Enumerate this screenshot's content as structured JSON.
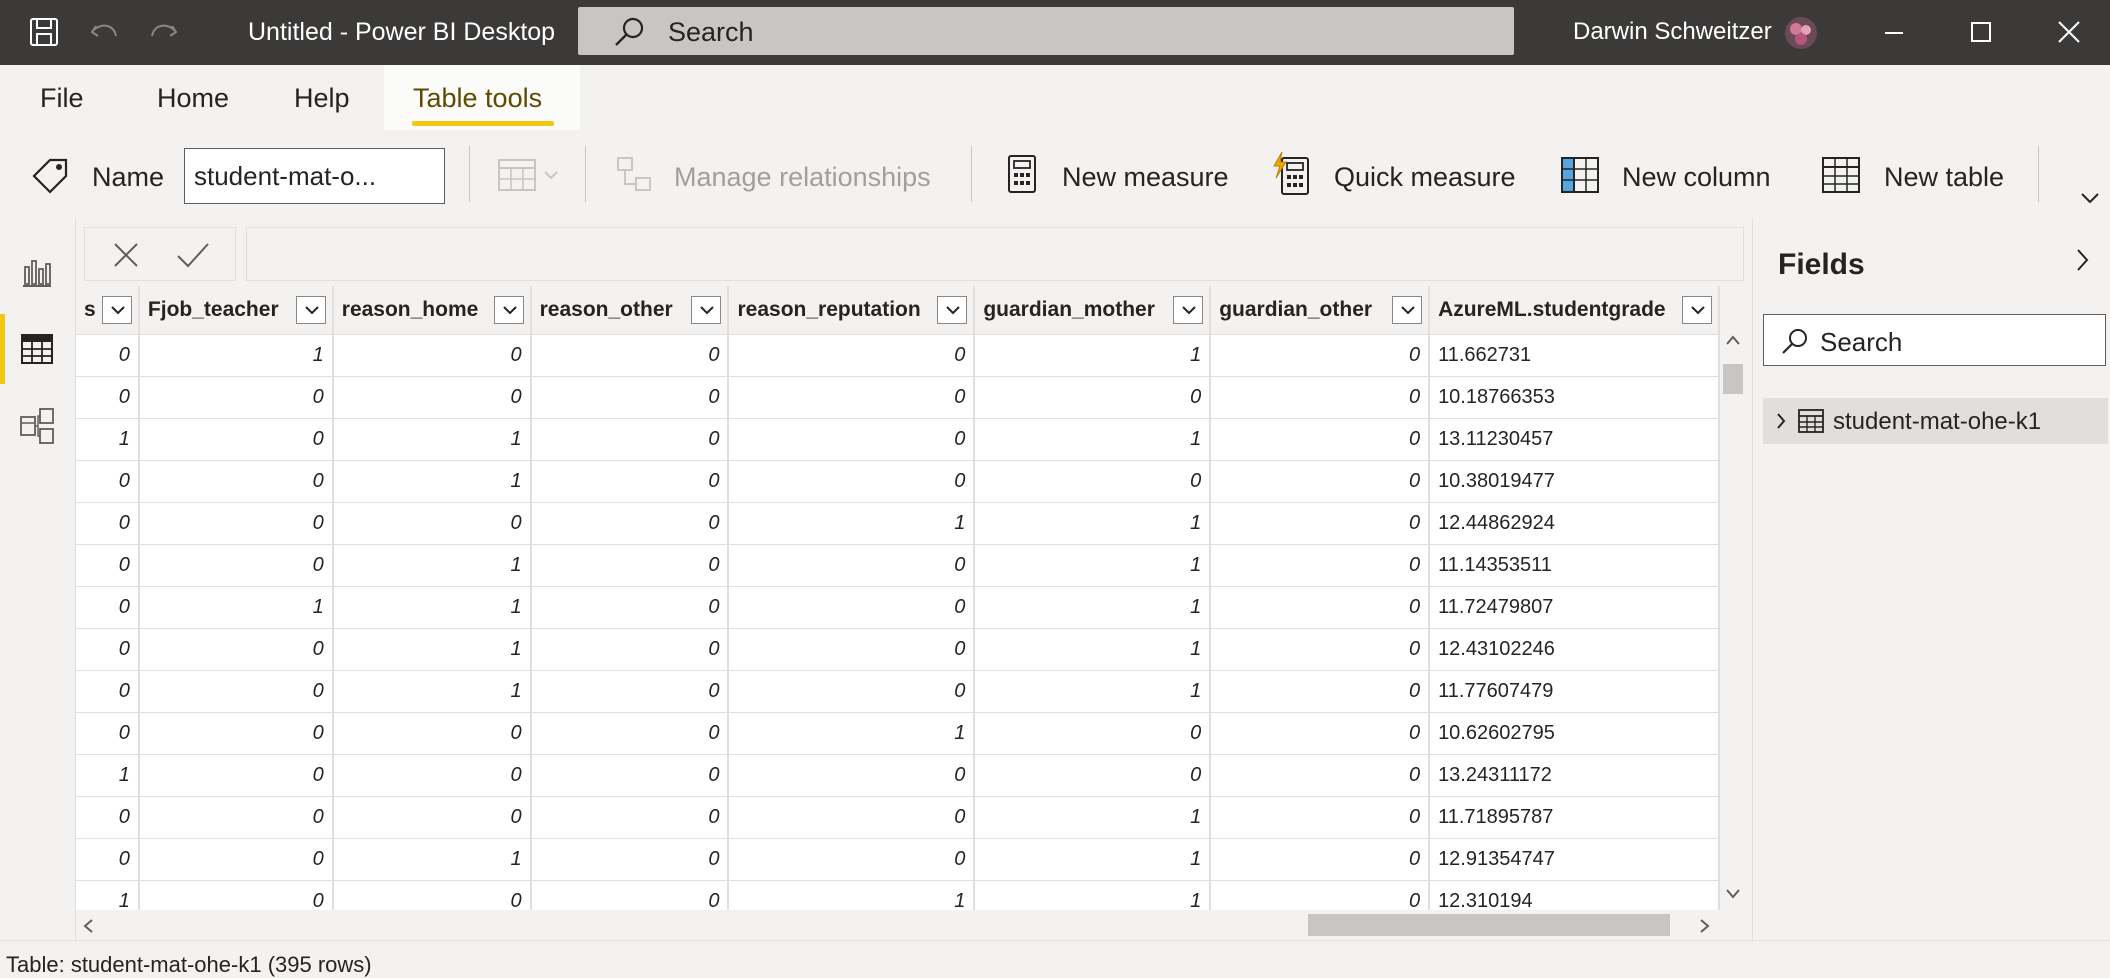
{
  "titlebar": {
    "title": "Untitled - Power BI Desktop",
    "search_placeholder": "Search",
    "user_name": "Darwin Schweitzer"
  },
  "menu": {
    "file": "File",
    "home": "Home",
    "help": "Help",
    "table_tools": "Table tools"
  },
  "ribbon": {
    "name_label": "Name",
    "name_value": "student-mat-o...",
    "manage_relationships": "Manage relationships",
    "new_measure": "New measure",
    "quick_measure": "Quick measure",
    "new_column": "New column",
    "new_table": "New table"
  },
  "table": {
    "columns": [
      "s",
      "Fjob_teacher",
      "reason_home",
      "reason_other",
      "reason_reputation",
      "guardian_mother",
      "guardian_other",
      "AzureML.studentgrade"
    ],
    "rows": [
      [
        "0",
        "1",
        "0",
        "0",
        "0",
        "1",
        "0",
        "11.662731"
      ],
      [
        "0",
        "0",
        "0",
        "0",
        "0",
        "0",
        "0",
        "10.18766353"
      ],
      [
        "1",
        "0",
        "1",
        "0",
        "0",
        "1",
        "0",
        "13.11230457"
      ],
      [
        "0",
        "0",
        "1",
        "0",
        "0",
        "0",
        "0",
        "10.38019477"
      ],
      [
        "0",
        "0",
        "0",
        "0",
        "1",
        "1",
        "0",
        "12.44862924"
      ],
      [
        "0",
        "0",
        "1",
        "0",
        "0",
        "1",
        "0",
        "11.14353511"
      ],
      [
        "0",
        "1",
        "1",
        "0",
        "0",
        "1",
        "0",
        "11.72479807"
      ],
      [
        "0",
        "0",
        "1",
        "0",
        "0",
        "1",
        "0",
        "12.43102246"
      ],
      [
        "0",
        "0",
        "1",
        "0",
        "0",
        "1",
        "0",
        "11.77607479"
      ],
      [
        "0",
        "0",
        "0",
        "0",
        "1",
        "0",
        "0",
        "10.62602795"
      ],
      [
        "1",
        "0",
        "0",
        "0",
        "0",
        "0",
        "0",
        "13.24311172"
      ],
      [
        "0",
        "0",
        "0",
        "0",
        "0",
        "1",
        "0",
        "11.71895787"
      ],
      [
        "0",
        "0",
        "1",
        "0",
        "0",
        "1",
        "0",
        "12.91354747"
      ],
      [
        "1",
        "0",
        "0",
        "0",
        "1",
        "1",
        "0",
        "12.310194"
      ]
    ]
  },
  "fields": {
    "title": "Fields",
    "search_placeholder": "Search",
    "table_name": "student-mat-ohe-k1"
  },
  "status": {
    "text": "Table: student-mat-ohe-k1 (395 rows)"
  },
  "colors": {
    "accent": "#f2c811",
    "titlebar": "#3b3a39"
  }
}
